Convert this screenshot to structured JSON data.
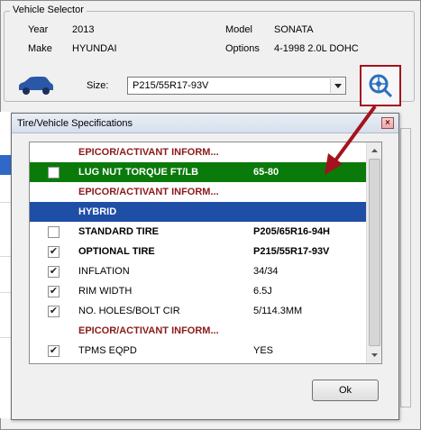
{
  "vehicle_selector": {
    "title": "Vehicle Selector",
    "year_label": "Year",
    "year_value": "2013",
    "make_label": "Make",
    "make_value": "HYUNDAI",
    "model_label": "Model",
    "model_value": "SONATA",
    "options_label": "Options",
    "options_value": "4-1998 2.0L DOHC",
    "size_label": "Size:",
    "size_value": "P215/55R17-93V"
  },
  "colors": {
    "header_text": "#8b1a1a",
    "green_row": "#0a7a0a",
    "blue_row": "#1f4ea6",
    "annotation": "#a3121e"
  },
  "modal": {
    "title": "Tire/Vehicle Specifications",
    "ok_label": "Ok",
    "rows": [
      {
        "type": "header",
        "name": "EPICOR/ACTIVANT INFORM...",
        "value": "",
        "checked": null
      },
      {
        "type": "green",
        "name": "LUG NUT TORQUE FT/LB",
        "value": "65-80",
        "checked": false
      },
      {
        "type": "header",
        "name": "EPICOR/ACTIVANT INFORM...",
        "value": "",
        "checked": null
      },
      {
        "type": "blue",
        "name": "HYBRID",
        "value": "",
        "checked": null
      },
      {
        "type": "bold",
        "name": "STANDARD TIRE",
        "value": "P205/65R16-94H",
        "checked": false
      },
      {
        "type": "bold",
        "name": "OPTIONAL TIRE",
        "value": "P215/55R17-93V",
        "checked": true
      },
      {
        "type": "normal",
        "name": "INFLATION",
        "value": "34/34",
        "checked": true
      },
      {
        "type": "normal",
        "name": "RIM WIDTH",
        "value": "6.5J",
        "checked": true
      },
      {
        "type": "normal",
        "name": "NO. HOLES/BOLT CIR",
        "value": "5/114.3MM",
        "checked": true
      },
      {
        "type": "header",
        "name": "EPICOR/ACTIVANT INFORM...",
        "value": "",
        "checked": null
      },
      {
        "type": "normal",
        "name": "TPMS EQPD",
        "value": "YES",
        "checked": true
      }
    ]
  }
}
